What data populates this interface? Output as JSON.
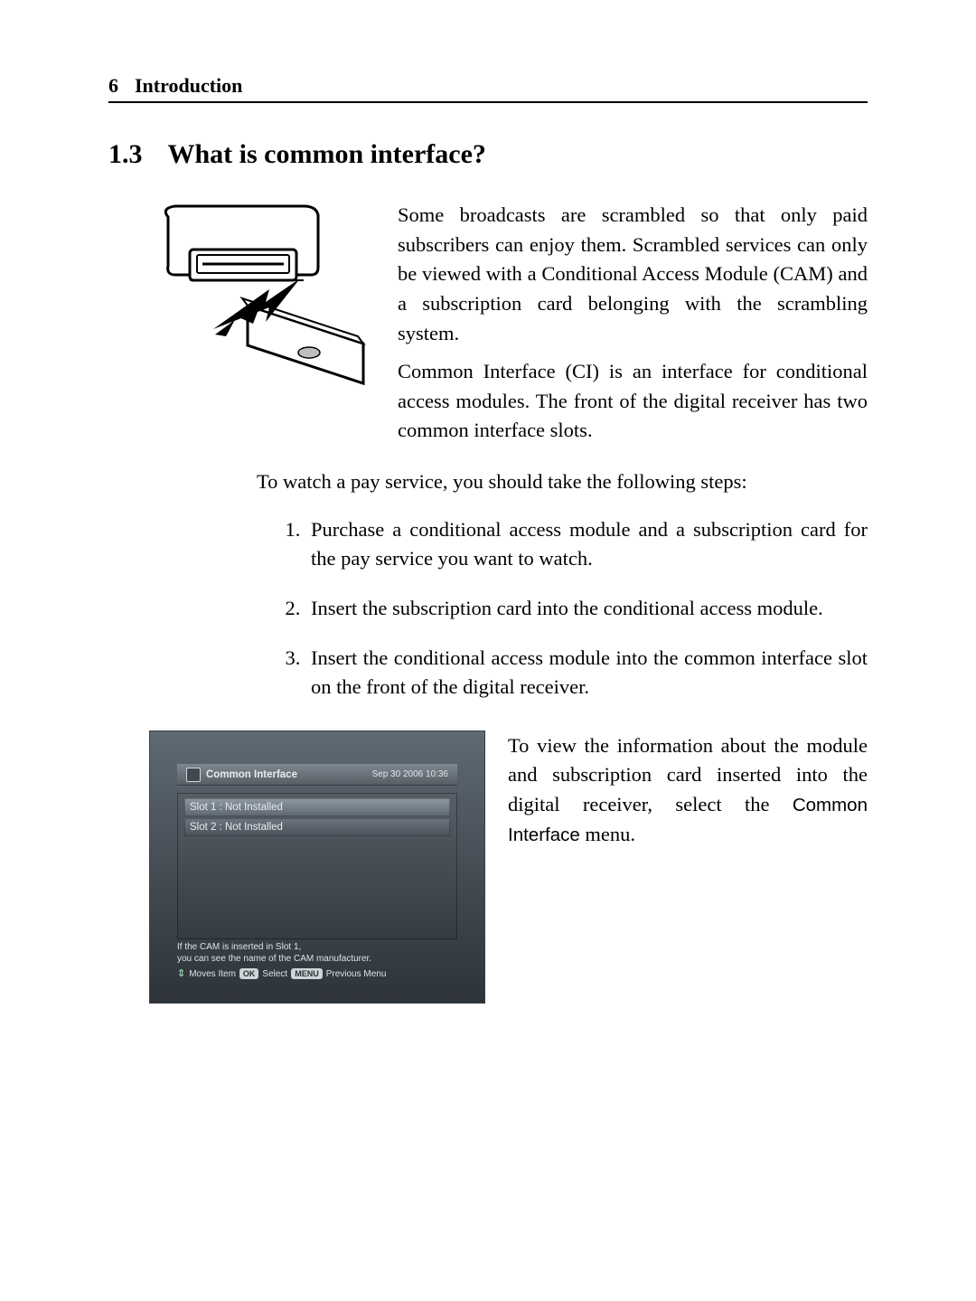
{
  "header": {
    "page_number": "6",
    "chapter_title": "Introduction"
  },
  "section": {
    "number": "1.3",
    "title": "What is common interface?"
  },
  "body": {
    "para1": "Some broadcasts are scrambled so that only paid subscribers can enjoy them. Scrambled services can only be viewed with a Conditional Access Module (CAM) and a subscription card belonging with the scrambling system.",
    "para2": "Common Interface (CI) is an interface for conditional access modules. The front of the digital receiver has two common interface slots.",
    "lead": "To watch a pay service, you should take the following steps:",
    "steps": [
      "Purchase a conditional access module and a subscription card for the pay service you want to watch.",
      "Insert the subscription card into the conditional access module.",
      "Insert the conditional access module into the common interface slot on the front of the digital receiver."
    ],
    "para3_pre": "To view the information about the module and subscription card inserted into the digital receiver, select the ",
    "menu_name": "Common Interface",
    "para3_post": " menu."
  },
  "tv": {
    "title": "Common Interface",
    "timestamp": "Sep 30 2006 10:36",
    "slots": [
      "Slot 1 : Not Installed",
      "Slot 2 : Not Installed"
    ],
    "hint_line1": "If the CAM is inserted in Slot 1,",
    "hint_line2": "you can see the name of the CAM manufacturer.",
    "help_moves": "Moves Item",
    "help_ok": "OK",
    "help_select": "Select",
    "help_menu": "MENU",
    "help_prev": "Previous Menu"
  }
}
